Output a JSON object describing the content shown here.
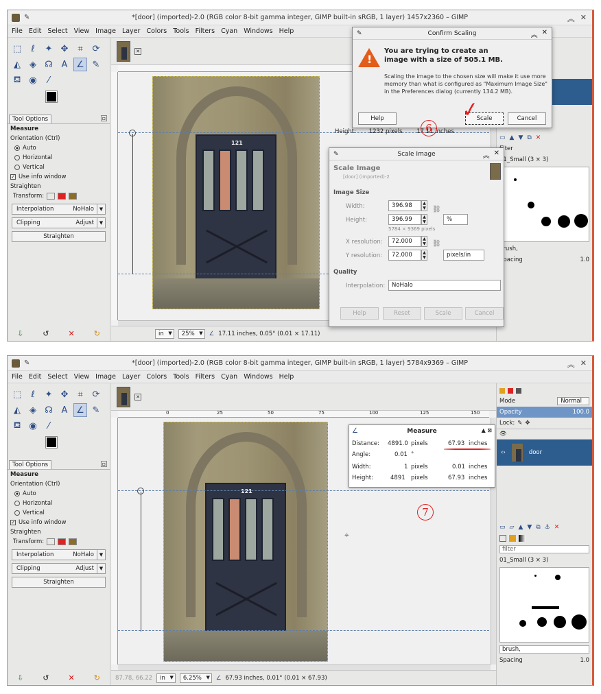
{
  "shot1": {
    "title": "*[door] (imported)-2.0 (RGB color 8-bit gamma integer, GIMP built-in sRGB, 1 layer) 1457x2360 – GIMP",
    "zoom": "25%",
    "unit": "in",
    "status": "17.11 inches, 0.05° (0.01 × 17.11)",
    "confirm": {
      "title": "Confirm Scaling",
      "heading": "You are trying to create an image with a size of 505.1 MB.",
      "body": "Scaling the image to the chosen size will make it use more memory than what is configured as \"Maximum Image Size\" in the Preferences dialog (currently 134.2 MB).",
      "help": "Help",
      "scale": "Scale",
      "cancel": "Cancel"
    },
    "scale_dialog": {
      "title": "Scale Image",
      "heading": "Scale Image",
      "sub": "[door] (imported)-2",
      "image_size": "Image Size",
      "width_label": "Width:",
      "width": "396.98",
      "height_label": "Height:",
      "height": "396.99",
      "pixels_note": "5784 × 9369 pixels",
      "unit": "%",
      "xres_label": "X resolution:",
      "xres": "72.000",
      "yres_label": "Y resolution:",
      "yres": "72.000",
      "res_unit": "pixels/in",
      "quality": "Quality",
      "interp_label": "Interpolation:",
      "interp": "NoHalo",
      "help": "Help",
      "reset": "Reset",
      "scale": "Scale",
      "cancel": "Cancel"
    },
    "behind_measure": {
      "height_label": "Height:",
      "height_px": "1232",
      "px": "pixels",
      "height_in": "17.11",
      "in": "inches"
    },
    "step": "6"
  },
  "shot2": {
    "title": "*[door] (imported)-2.0 (RGB color 8-bit gamma integer, GIMP built-in sRGB, 1 layer) 5784x9369 – GIMP",
    "zoom": "6.25%",
    "unit": "in",
    "coords": "87.78, 66.22",
    "status": "67.93 inches, 0.01° (0.01 × 67.93)",
    "measure": {
      "title": "Measure",
      "distance_label": "Distance:",
      "distance_px": "4891.0",
      "distance_in": "67.93",
      "angle_label": "Angle:",
      "angle": "0.01",
      "deg": "°",
      "width_label": "Width:",
      "width_px": "1",
      "width_in": "0.01",
      "height_label": "Height:",
      "height_px": "4891",
      "height_in": "67.93",
      "px": "pixels",
      "in": "inches"
    },
    "step": "7"
  },
  "menu": [
    "File",
    "Edit",
    "Select",
    "View",
    "Image",
    "Layer",
    "Colors",
    "Tools",
    "Filters",
    "Cyan",
    "Windows",
    "Help"
  ],
  "tool_options": {
    "tab": "Tool Options",
    "tool": "Measure",
    "orientation": "Orientation (Ctrl)",
    "auto": "Auto",
    "horizontal": "Horizontal",
    "vertical": "Vertical",
    "info_window": "Use info window",
    "straighten_heading": "Straighten",
    "transform": "Transform:",
    "interpolation": "Interpolation",
    "interp_value": "NoHalo",
    "clipping": "Clipping",
    "clip_value": "Adjust",
    "straighten_btn": "Straighten"
  },
  "dock": {
    "mode_label": "Mode",
    "mode": "Normal",
    "opacity_label": "Opacity",
    "opacity": "100.0",
    "lock": "Lock:",
    "layer_name": "door",
    "filter": "filter",
    "brush_set": "01_Small (3 × 3)",
    "brush": "brush,",
    "spacing_label": "Spacing",
    "spacing": "1.0"
  },
  "door_number": "121",
  "ruler2": [
    "0",
    "25",
    "50",
    "75",
    "100",
    "125",
    "150"
  ],
  "colors": {
    "selection": "#2c5d8e",
    "warning": "#e35d1a",
    "annotation": "#dd2222"
  }
}
